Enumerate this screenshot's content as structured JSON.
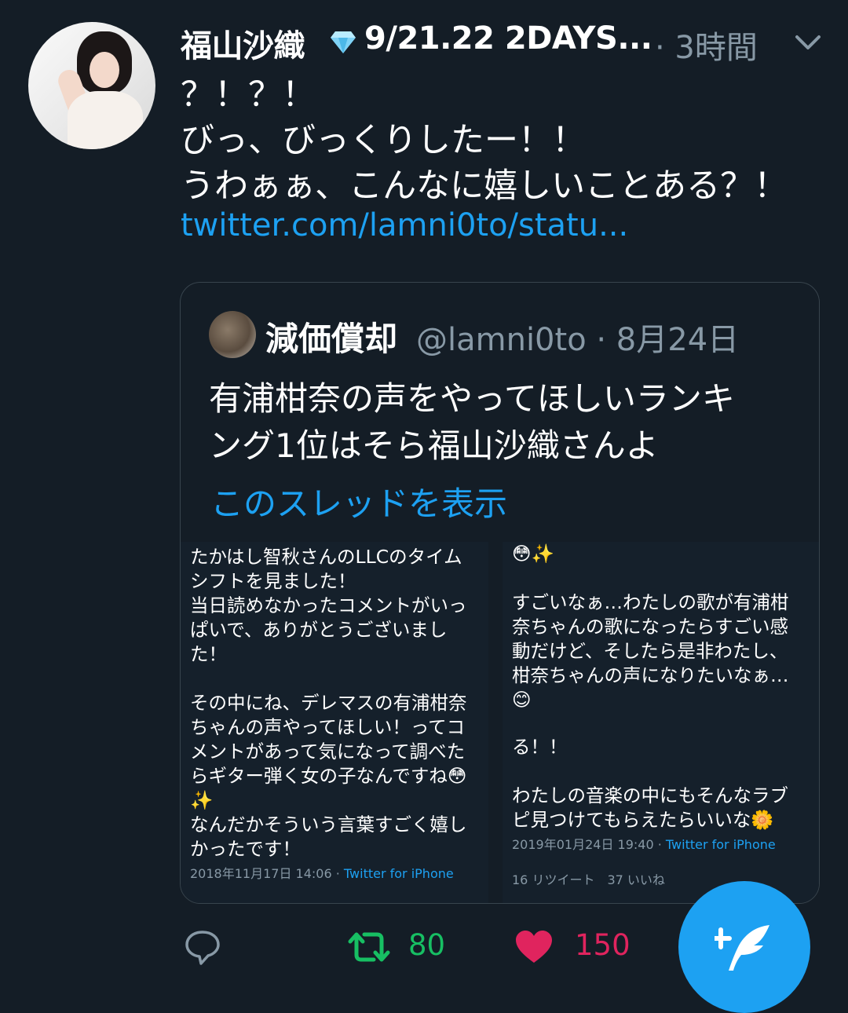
{
  "tweet": {
    "author_name": "福山沙織",
    "author_suffix": "9/21.22 2DAYS...",
    "time": "· 3時間",
    "lines": [
      "？！？！",
      "びっ、びっくりしたー！！",
      "うわぁぁ、こんなに嬉しいことある？！"
    ],
    "link": "twitter.com/lamni0to/statu..."
  },
  "quote": {
    "name": "減価償却",
    "handle": "@lamni0to · 8月24日",
    "lines": [
      "有浦柑奈の声をやってほしいランキ",
      "ング1位はそら福山沙織さんよ"
    ],
    "thread_link": "このスレッドを表示"
  },
  "screenshot_left": {
    "lines": [
      "たかはし智秋さんのLLCのタイム",
      "シフトを見ました！",
      "当日読めなかったコメントがいっ",
      "ぱいで、ありがとうございまし",
      "た！",
      "",
      "その中にね、デレマスの有浦柑奈",
      "ちゃんの声やってほしい！ってコ",
      "メントがあって気になって調べた",
      "らギター弾く女の子なんですね😳",
      "✨",
      "なんだかそういう言葉すごく嬉し",
      "かったです！"
    ],
    "date": "2018年11月17日 14:06 · ",
    "source": "Twitter for iPhone"
  },
  "screenshot_right": {
    "top_lines": [
      "😳✨",
      "",
      "すごいなぁ…わたしの歌が有浦柑",
      "奈ちゃんの歌になったらすごい感",
      "動だけど、そしたら是非わたし、",
      "柑奈ちゃんの声になりたいなぁ…",
      "😊"
    ],
    "bottom_lines": [
      "る！！",
      "",
      "わたしの音楽の中にもそんなラブ",
      "ピ見つけてもらえたらいいな🌼"
    ],
    "date": "2019年01月24日 19:40 · ",
    "source": "Twitter for iPhone",
    "stats": "16 リツイート　37 いいね"
  },
  "actions": {
    "retweet_count": "80",
    "like_count": "150",
    "retweet_color": "#17bf63",
    "like_color": "#e0245e",
    "fab_color": "#1da1f2"
  }
}
